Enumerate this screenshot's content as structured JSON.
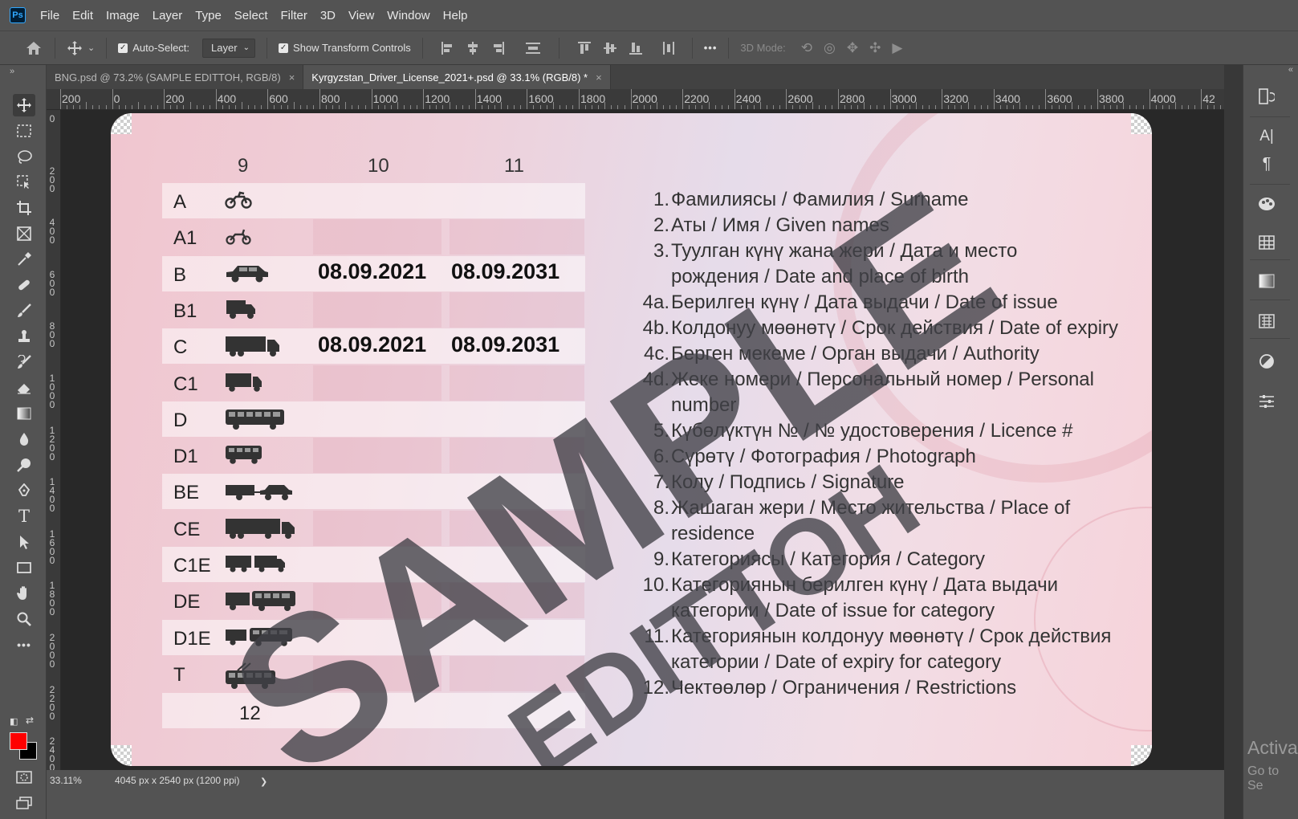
{
  "menu": [
    "File",
    "Edit",
    "Image",
    "Layer",
    "Type",
    "Select",
    "Filter",
    "3D",
    "View",
    "Window",
    "Help"
  ],
  "app_logo": "Ps",
  "options": {
    "auto_select_label": "Auto-Select:",
    "layer_dropdown": "Layer",
    "show_transform_label": "Show Transform Controls",
    "more": "•••",
    "mode_label": "3D Mode:"
  },
  "tabs": [
    {
      "label": "BNG.psd @ 73.2% (SAMPLE EDITTOH, RGB/8)",
      "close": "×"
    },
    {
      "label": "Kyrgyzstan_Driver_License_2021+.psd @ 33.1% (RGB/8) *",
      "close": "×"
    }
  ],
  "ruler_h": [
    "200",
    "0",
    "200",
    "400",
    "600",
    "800",
    "1000",
    "1200",
    "1400",
    "1600",
    "1800",
    "2000",
    "2200",
    "2400",
    "2600",
    "2800",
    "3000",
    "3200",
    "3400",
    "3600",
    "3800",
    "4000",
    "42"
  ],
  "ruler_v": [
    "0",
    "200",
    "400",
    "600",
    "800",
    "1000",
    "1200",
    "1400",
    "1600",
    "1800",
    "2000",
    "2200",
    "2400"
  ],
  "license": {
    "col_numbers": [
      "9",
      "10",
      "11"
    ],
    "categories": [
      "A",
      "A1",
      "B",
      "B1",
      "C",
      "C1",
      "D",
      "D1",
      "BE",
      "CE",
      "C1E",
      "DE",
      "D1E",
      "T"
    ],
    "vehicle_icons": [
      "motorcycle-icon",
      "scooter-icon",
      "car-icon",
      "van-icon",
      "truck-icon",
      "small-truck-icon",
      "bus-icon",
      "minibus-icon",
      "car-trailer-icon",
      "truck-trailer-icon",
      "small-truck-trailer-icon",
      "bus-trailer-icon",
      "minibus-trailer-icon",
      "trolleybus-icon"
    ],
    "dates": {
      "B": {
        "issue": "08.09.2021",
        "expiry": "08.09.2031"
      },
      "C": {
        "issue": "08.09.2021",
        "expiry": "08.09.2031"
      }
    },
    "restrictions_num": "12",
    "legend": [
      {
        "num": "1.",
        "text": "Фамилиясы / Фамилия / Surname"
      },
      {
        "num": "2.",
        "text": "Аты / Имя / Given names"
      },
      {
        "num": "3.",
        "text": "Туулган күнү жана жери / Дата и место"
      },
      {
        "num": "",
        "text": "рождения / Date and place of birth"
      },
      {
        "num": "4a.",
        "text": "Берилген күнү / Дата выдачи / Date of issue"
      },
      {
        "num": "4b.",
        "text": "Колдонуу мөөнөтү / Срок действия / Date of expiry"
      },
      {
        "num": "4c.",
        "text": "Берген мекеме / Орган выдачи / Authority"
      },
      {
        "num": "4d.",
        "text": "Жеке номери / Персональный номер / Personal"
      },
      {
        "num": "",
        "text": "number"
      },
      {
        "num": "5.",
        "text": "Күбөлүктүн № / № удостоверения / Licence #"
      },
      {
        "num": "6.",
        "text": "Сүрөтү / Фотография / Photograph"
      },
      {
        "num": "7.",
        "text": "Колу / Подпись / Signature"
      },
      {
        "num": "8.",
        "text": "Жашаган жери / Место жительства / Place of"
      },
      {
        "num": "",
        "text": "residence"
      },
      {
        "num": "9.",
        "text": "Категориясы / Категория / Category"
      },
      {
        "num": "10.",
        "text": "Категориянын берилген күнү / Дата выдачи"
      },
      {
        "num": "",
        "text": "категории / Date of issue for category"
      },
      {
        "num": "11.",
        "text": "Категориянын колдонуу мөөнөтү / Срок действия"
      },
      {
        "num": "",
        "text": "категории / Date of expiry for category"
      },
      {
        "num": "12.",
        "text": "Чектөөлөр / Ограничения / Restrictions"
      }
    ],
    "watermark_main": "SAMPLE",
    "watermark_sub": "EDITTOH"
  },
  "status": {
    "zoom": "33.11%",
    "doc_size": "4045 px x 2540 px (1200 ppi)",
    "arrow": "❯"
  },
  "activate": {
    "line1": "Activa",
    "line2": "Go to Se"
  },
  "colors": {
    "foreground": "#ff0000",
    "background": "#000000"
  }
}
